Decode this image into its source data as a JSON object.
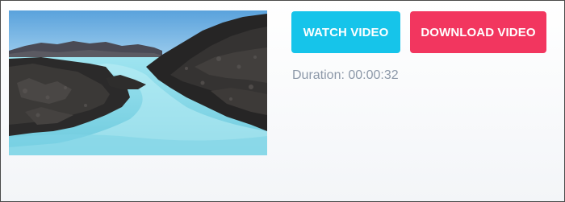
{
  "actions": {
    "watch_label": "WATCH VIDEO",
    "download_label": "DOWNLOAD VIDEO"
  },
  "meta": {
    "duration_text": "Duration: 00:00:32"
  },
  "colors": {
    "watch_button": "#16c4ea",
    "download_button": "#f2365f",
    "duration_text": "#8c98a8"
  }
}
